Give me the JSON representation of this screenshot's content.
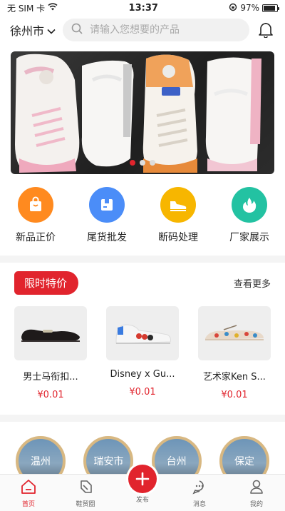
{
  "status_bar": {
    "carrier": "无 SIM 卡",
    "time": "13:37",
    "battery": "97%"
  },
  "header": {
    "city": "徐州市",
    "search_placeholder": "请输入您想要的产品"
  },
  "banner": {
    "slides": 3,
    "active_slide": 1
  },
  "categories": [
    {
      "label": "新品正价",
      "icon": "shopping-bag-icon",
      "color": "#ff8a1f"
    },
    {
      "label": "尾货批发",
      "icon": "box-icon",
      "color": "#4b8df8"
    },
    {
      "label": "断码处理",
      "icon": "shoe-icon",
      "color": "#f7b600"
    },
    {
      "label": "厂家展示",
      "icon": "flame-icon",
      "color": "#23c2a2"
    }
  ],
  "special": {
    "tag": "限时特价",
    "more": "查看更多",
    "products": [
      {
        "name": "男士马衔扣...",
        "price": "¥0.01"
      },
      {
        "name": "Disney x Gu...",
        "price": "¥0.01"
      },
      {
        "name": "艺术家Ken S...",
        "price": "¥0.01"
      }
    ]
  },
  "cities": [
    "温州",
    "瑞安市",
    "台州",
    "保定"
  ],
  "tabbar": [
    {
      "label": "首页",
      "active": true
    },
    {
      "label": "鞋贸圈",
      "active": false
    },
    {
      "label": "发布",
      "active": false
    },
    {
      "label": "消息",
      "active": false
    },
    {
      "label": "我的",
      "active": false
    }
  ],
  "colors": {
    "accent": "#e1242d"
  }
}
